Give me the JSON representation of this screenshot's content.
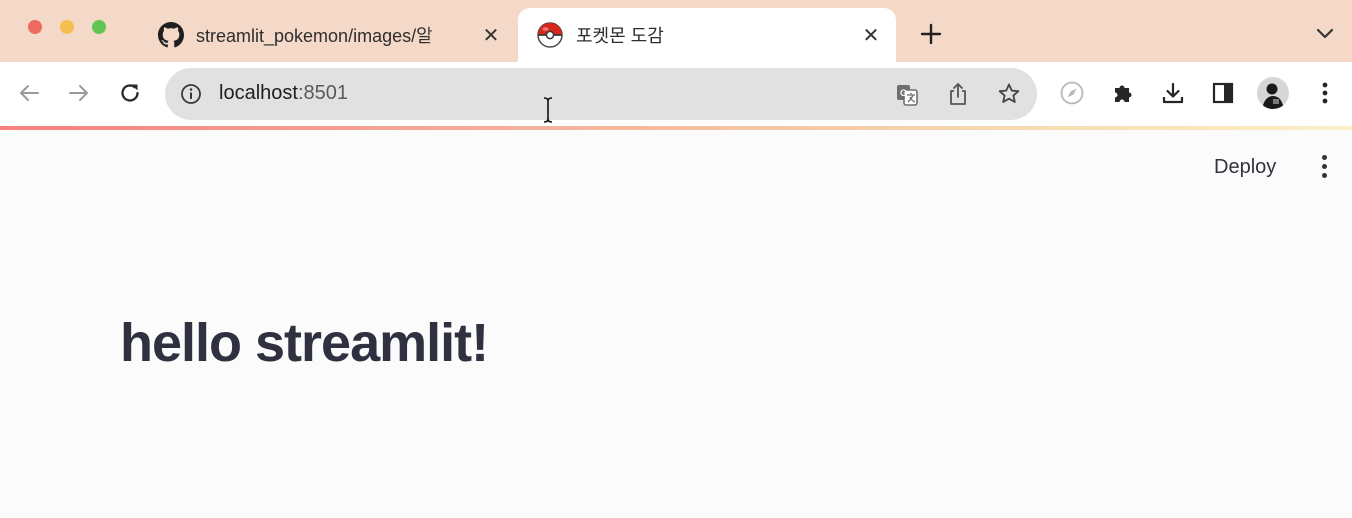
{
  "browser": {
    "tabs": [
      {
        "title": "streamlit_pokemon/images/알",
        "favicon": "github-icon",
        "active": false
      },
      {
        "title": "포켓몬 도감",
        "favicon": "pokeball-icon",
        "active": true
      }
    ],
    "new_tab_symbol": "+",
    "close_symbol": "✕",
    "address": {
      "host": "localhost",
      "port": ":8501"
    },
    "colors": {
      "titlebar": "#f5d9c8",
      "close": "#ec6a5e",
      "minimize": "#f4bf4f",
      "maximize": "#61c554"
    }
  },
  "app": {
    "deploy_label": "Deploy",
    "heading": "hello streamlit!"
  }
}
